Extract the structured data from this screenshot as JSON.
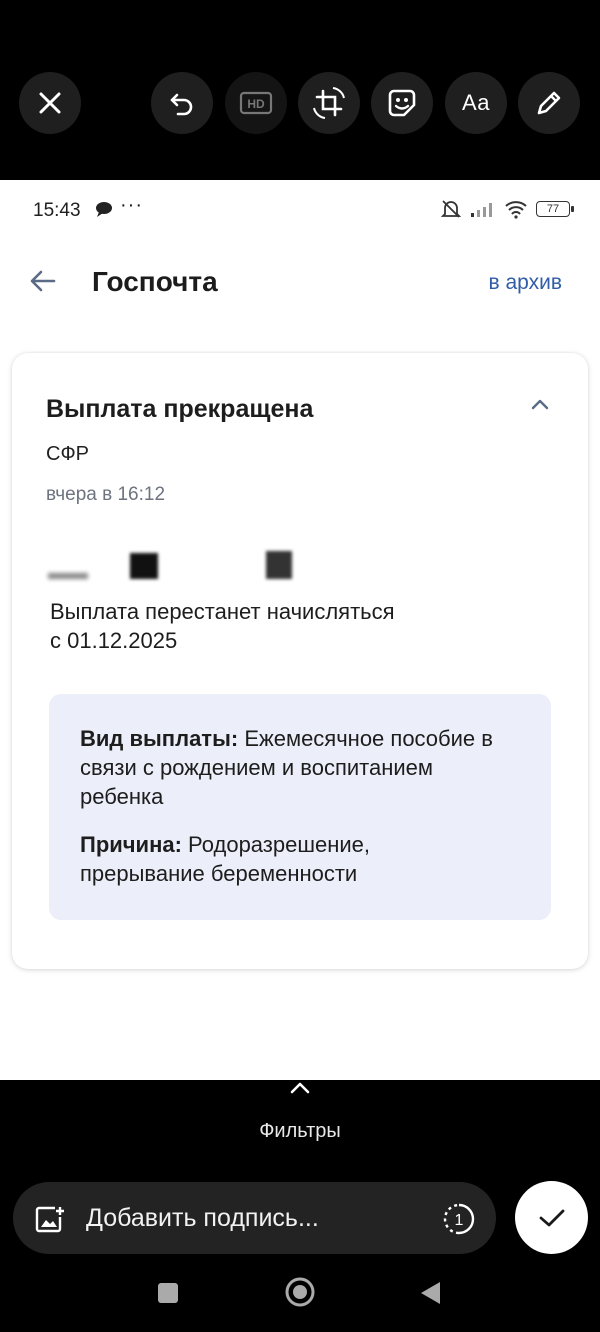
{
  "editor_toolbar": {
    "buttons": [
      "close-icon",
      "undo-icon",
      "hd-icon",
      "crop-rotate-icon",
      "sticker-icon",
      "text-icon",
      "pen-icon"
    ],
    "text_label": "Aa",
    "hd_label": "HD"
  },
  "status_bar": {
    "time": "15:43",
    "dots": "···",
    "battery": "77"
  },
  "header": {
    "title": "Госпочта",
    "archive_link": "в архив"
  },
  "card": {
    "title": "Выплата прекращена",
    "sender": "СФР",
    "date": "вчера в 16:12",
    "message_line1": "Выплата перестанет начисляться",
    "message_line2": "с 01.12.2025",
    "info": {
      "type_label": "Вид выплаты:",
      "type_value_line1": " Ежемесячное пособие в",
      "type_value_line2": "связи с рождением и воспитанием",
      "type_value_line3": "ребенка",
      "reason_label": "Причина:",
      "reason_value_line1": " Родоразрешение,",
      "reason_value_line2": "прерывание беременности"
    }
  },
  "bottom": {
    "filters_label": "Фильтры",
    "caption_placeholder": "Добавить подпись...",
    "view_once_label": "1"
  },
  "colors": {
    "accent_link": "#2f5da6",
    "info_bg": "#eceff9"
  }
}
